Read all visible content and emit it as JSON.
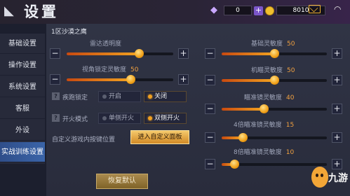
{
  "header": {
    "title": "设置",
    "gems": "0",
    "gold": "8010",
    "icons": {
      "logo": "app-logo-icon",
      "gem": "diamond-icon",
      "coin": "gold-coin-icon",
      "mail": "mail-icon",
      "wifi": "wifi-icon"
    }
  },
  "sidebar": {
    "items": [
      {
        "label": "基础设置",
        "active": false
      },
      {
        "label": "操作设置",
        "active": false
      },
      {
        "label": "系统设置",
        "active": false
      },
      {
        "label": "客服",
        "active": false
      },
      {
        "label": "外设",
        "active": false
      },
      {
        "label": "实战训练设置",
        "active": true
      }
    ]
  },
  "main": {
    "section_title": "1区沙漠之鹰",
    "sliders_left": [
      {
        "label": "雷达透明度",
        "value": "",
        "level": 0.68
      },
      {
        "label": "视角锁定灵敏度",
        "value": "50",
        "level": 0.6
      }
    ],
    "toggles": [
      {
        "label": "疾跑锁定",
        "options": [
          "开启",
          "关闭"
        ],
        "selected": 1
      },
      {
        "label": "开火模式",
        "options": [
          "单侧开火",
          "双侧开火"
        ],
        "selected": 1
      }
    ],
    "custom_label": "自定义游戏内按键位置",
    "custom_button": "进入自定义面板",
    "sliders_right": [
      {
        "label": "基础灵敏度",
        "value": "50",
        "level": 0.5
      },
      {
        "label": "机瞄灵敏度",
        "value": "50",
        "level": 0.5
      },
      {
        "label": "瞄准镜灵敏度",
        "value": "40",
        "level": 0.4
      },
      {
        "label": "4倍瞄准镜灵敏度",
        "value": "15",
        "level": 0.2
      },
      {
        "label": "8倍瞄准镜灵敏度",
        "value": "10",
        "level": 0.12
      }
    ],
    "minus": "−",
    "plus": "+",
    "help": "?"
  },
  "footer": {
    "reset_button": "恢复默认"
  },
  "watermark": {
    "text": "九游"
  },
  "colors": {
    "accent": "#f0a020",
    "active_tab": "#3a64a8",
    "panel": "#2c3040"
  }
}
